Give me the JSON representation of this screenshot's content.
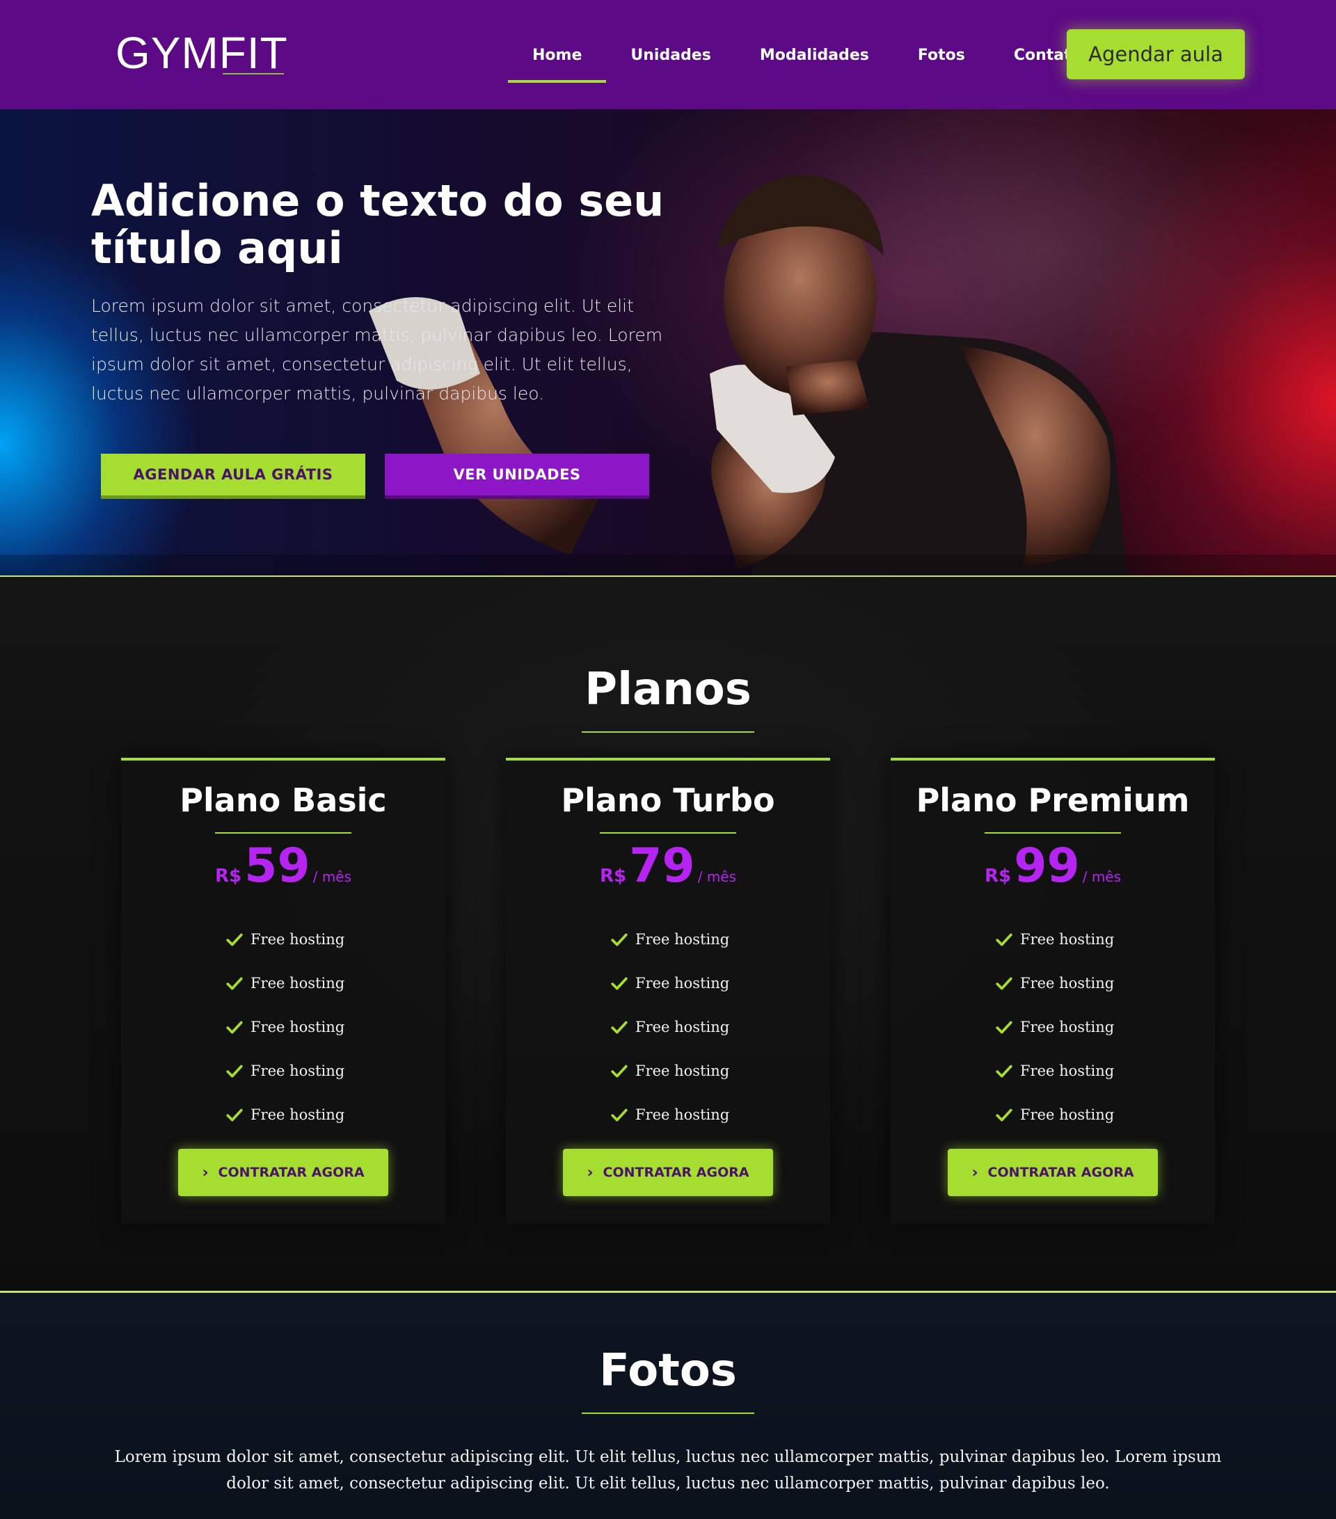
{
  "header": {
    "logo": "GYMFIT",
    "nav": [
      {
        "label": "Home",
        "active": true
      },
      {
        "label": "Unidades",
        "active": false
      },
      {
        "label": "Modalidades",
        "active": false
      },
      {
        "label": "Fotos",
        "active": false
      },
      {
        "label": "Contato",
        "active": false
      }
    ],
    "cta_label": "Agendar aula"
  },
  "hero": {
    "title": "Adicione o texto do seu título aqui",
    "text": "Lorem ipsum dolor sit amet, consectetur adipiscing elit. Ut elit tellus, luctus nec ullamcorper mattis, pulvinar dapibus leo. Lorem ipsum dolor sit amet, consectetur adipiscing elit. Ut elit tellus, luctus nec ullamcorper mattis, pulvinar dapibus leo.",
    "primary_button": "AGENDAR AULA GRÁTIS",
    "secondary_button": "VER UNIDADES"
  },
  "planos": {
    "title": "Planos",
    "plans": [
      {
        "name": "Plano Basic",
        "currency": "R$",
        "price": "59",
        "period": "/ mês",
        "features": [
          "Free hosting",
          "Free hosting",
          "Free hosting",
          "Free hosting",
          "Free hosting"
        ],
        "button": "CONTRATAR AGORA"
      },
      {
        "name": "Plano Turbo",
        "currency": "R$",
        "price": "79",
        "period": "/ mês",
        "features": [
          "Free hosting",
          "Free hosting",
          "Free hosting",
          "Free hosting",
          "Free hosting"
        ],
        "button": "CONTRATAR AGORA"
      },
      {
        "name": "Plano Premium",
        "currency": "R$",
        "price": "99",
        "period": "/ mês",
        "features": [
          "Free hosting",
          "Free hosting",
          "Free hosting",
          "Free hosting",
          "Free hosting"
        ],
        "button": "CONTRATAR AGORA"
      }
    ]
  },
  "fotos": {
    "title": "Fotos",
    "text": "Lorem ipsum dolor sit amet, consectetur adipiscing elit. Ut elit tellus, luctus nec ullamcorper mattis, pulvinar dapibus leo. Lorem ipsum dolor sit amet, consectetur adipiscing elit. Ut elit tellus, luctus nec ullamcorper mattis, pulvinar dapibus leo."
  },
  "colors": {
    "header_bg": "#5d0a86",
    "accent_green": "#a6dd31",
    "accent_purple": "#8d16c7",
    "price_purple": "#b524f0"
  },
  "icons": {
    "feature": "check-icon",
    "button": "chevron-right-icon"
  }
}
